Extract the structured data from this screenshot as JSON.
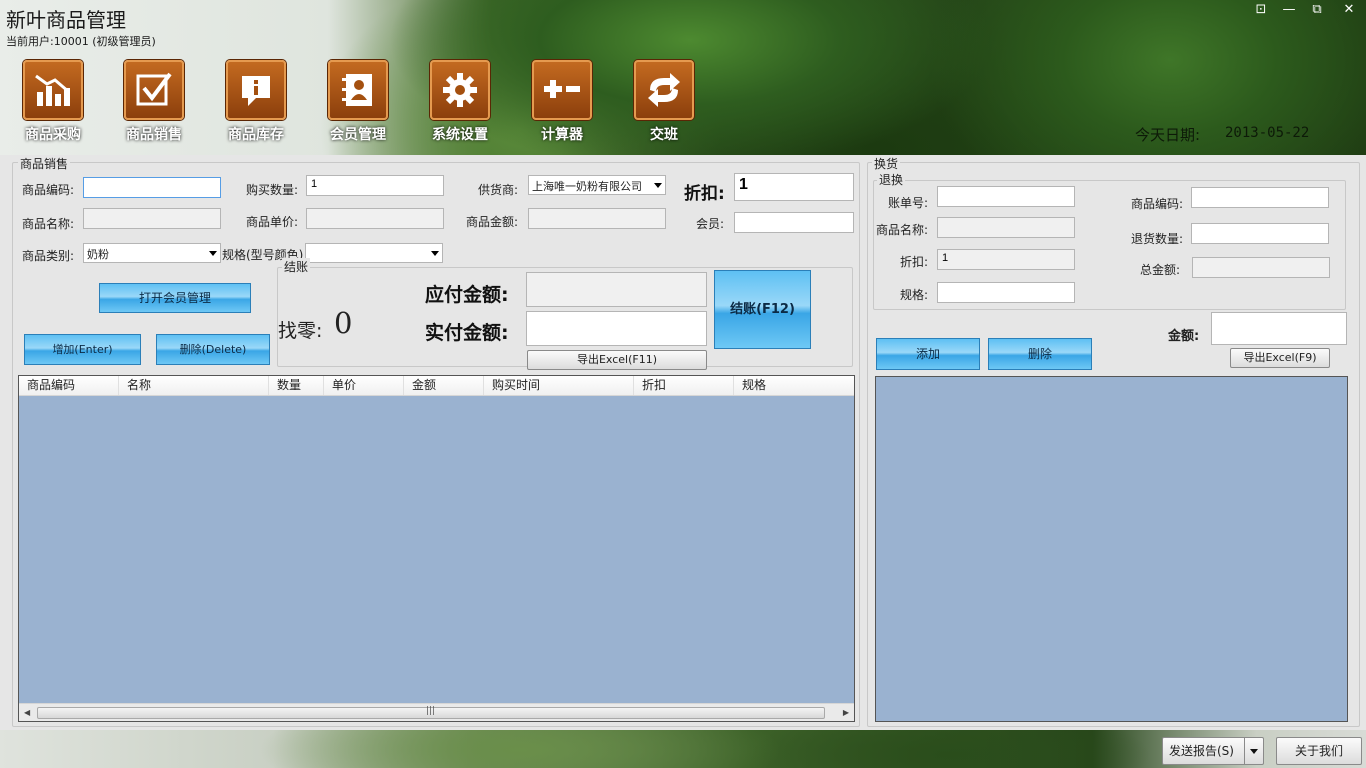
{
  "window": {
    "title": "新叶商品管理",
    "current_user": "当前用户:10001 (初级管理员)",
    "controls": [
      "⊡",
      "—",
      "⧉",
      "✕"
    ]
  },
  "nav": [
    {
      "label": "商品采购",
      "icon": "chart-icon"
    },
    {
      "label": "商品销售",
      "icon": "checkbox-icon"
    },
    {
      "label": "商品库存",
      "icon": "info-bubble-icon"
    },
    {
      "label": "会员管理",
      "icon": "contact-book-icon"
    },
    {
      "label": "系统设置",
      "icon": "gear-icon"
    },
    {
      "label": "计算器",
      "icon": "plus-minus-icon"
    },
    {
      "label": "交班",
      "icon": "swap-arrows-icon"
    }
  ],
  "today": {
    "label": "今天日期:",
    "value": "2013-05-22"
  },
  "sales": {
    "group_title": "商品销售",
    "product_code_label": "商品编码:",
    "product_code_value": "",
    "quantity_label": "购买数量:",
    "quantity_value": "1",
    "supplier_label": "供货商:",
    "supplier_value": "上海唯一奶粉有限公司",
    "discount_label": "折扣:",
    "discount_value": "1",
    "product_name_label": "商品名称:",
    "product_name_value": "",
    "unit_price_label": "商品单价:",
    "unit_price_value": "",
    "amount_label": "商品金额:",
    "amount_value": "",
    "member_label": "会员:",
    "member_value": "",
    "category_label": "商品类别:",
    "category_value": "奶粉",
    "spec_label": "规格(型号颜色)",
    "spec_value": "",
    "open_member_button": "打开会员管理",
    "add_button": "增加(Enter)",
    "delete_button": "删除(Delete)"
  },
  "checkout": {
    "group_title": "结账",
    "change_label": "找零:",
    "change_value": "0",
    "payable_label": "应付金额:",
    "payable_value": "",
    "paid_label": "实付金额:",
    "paid_value": "",
    "checkout_button": "结账(F12)",
    "export_button": "导出Excel(F11)"
  },
  "sales_grid": {
    "columns": [
      "商品编码",
      "名称",
      "数量",
      "单价",
      "金额",
      "购买时间",
      "折扣",
      "规格"
    ],
    "rows": [],
    "scroll_grip": "|||"
  },
  "exchange": {
    "group_title": "换货",
    "return_group_title": "退换",
    "bill_no_label": "账单号:",
    "bill_no_value": "",
    "product_name_label": "商品名称:",
    "product_name_value": "",
    "discount_label": "折扣:",
    "discount_value": "1",
    "spec_label": "规格:",
    "spec_value": "",
    "product_code_label": "商品编码:",
    "product_code_value": "",
    "return_qty_label": "退货数量:",
    "return_qty_value": "",
    "total_label": "总金额:",
    "total_value": "",
    "amount_label": "金额:",
    "amount_value": "",
    "add_button": "添加",
    "delete_button": "删除",
    "export_button": "导出Excel(F9)"
  },
  "footer": {
    "send_report_button": "发送报告(S)",
    "about_button": "关于我们"
  }
}
